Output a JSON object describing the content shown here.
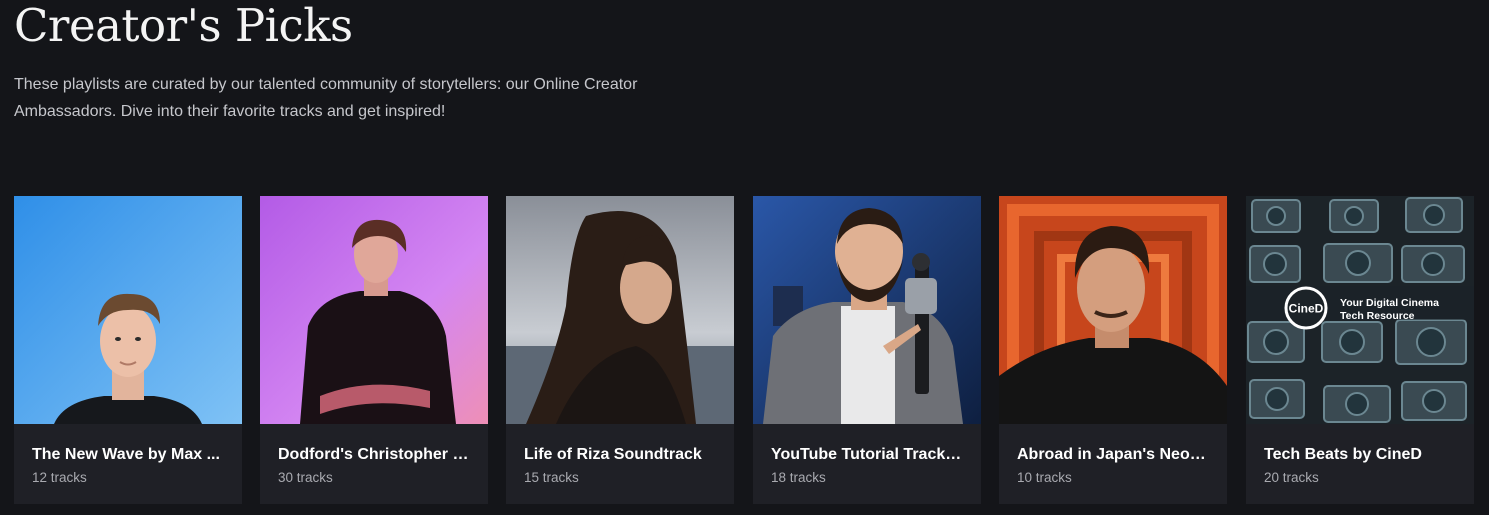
{
  "header": {
    "title": "Creator's Picks",
    "description": "These playlists are curated by our talented community of storytellers: our Online Creator Ambassadors. Dive into their favorite tracks and get inspired!"
  },
  "playlists": [
    {
      "title": "The New Wave by Max ...",
      "count": "12 tracks",
      "thumb_icon": "portrait-blue-background"
    },
    {
      "title": "Dodford's Christopher N...",
      "count": "30 tracks",
      "thumb_icon": "portrait-pink-background"
    },
    {
      "title": "Life of Riza Soundtrack",
      "count": "15 tracks",
      "thumb_icon": "portrait-seaside"
    },
    {
      "title": "YouTube Tutorial Tracks...",
      "count": "18 tracks",
      "thumb_icon": "portrait-with-camera-gimbal"
    },
    {
      "title": "Abroad in Japan's Neon ...",
      "count": "10 tracks",
      "thumb_icon": "portrait-torii-gates"
    },
    {
      "title": "Tech Beats by CineD",
      "count": "20 tracks",
      "thumb_icon": "cameras-collage-logo"
    }
  ],
  "brand_logo": {
    "name": "CineD",
    "tagline_line1": "Your Digital Cinema",
    "tagline_line2": "Tech Resource"
  },
  "colors": {
    "background": "#141519",
    "card_background": "#1f2026",
    "title_text": "#f4f4f4",
    "muted_text": "#a9aab0"
  }
}
